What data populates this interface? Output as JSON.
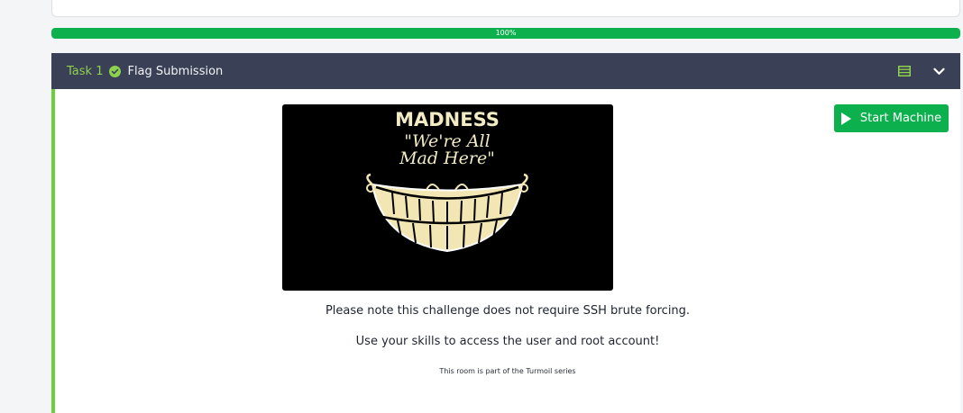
{
  "progress": {
    "label": "100%",
    "value": 100
  },
  "task": {
    "number_label": "Task 1",
    "title": "Flag Submission",
    "completed": true
  },
  "image": {
    "title": "MADNESS",
    "subtitle_line1": "\"We're All",
    "subtitle_line2": "Mad Here\""
  },
  "start_button": {
    "label": "Start Machine"
  },
  "body": {
    "note": "Please note this challenge does not require SSH brute forcing.",
    "skills": "Use your skills to access the user and root account!",
    "series": "This room is part of the Turmoil series"
  },
  "colors": {
    "header_bg": "#3a4055",
    "accent_green": "#8ed14d",
    "button_green": "#0cb04c",
    "task_border": "#6ccf3e"
  },
  "icons": [
    "check-circle-icon",
    "notes-icon",
    "chevron-down-icon",
    "play-icon"
  ]
}
